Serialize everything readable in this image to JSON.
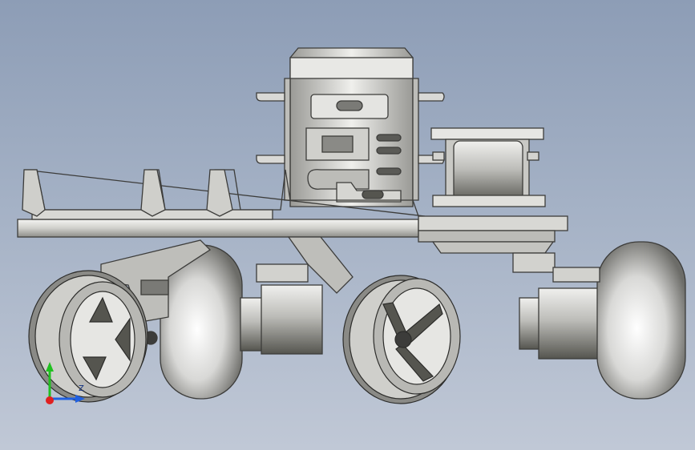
{
  "viewport": {
    "background_top": "#8d9db6",
    "background_bottom": "#c0c8d6",
    "model_name": "",
    "triad_axes": {
      "x_color": "#2060e0",
      "y_color": "#20c020",
      "z_color": "#e02020",
      "z_label": "Z"
    }
  },
  "model": {
    "icon": "robot-chassis-cad-model",
    "parts": [
      "chassis-plate",
      "upper-frame",
      "camera-mount",
      "battery-housing",
      "front-wheels",
      "rear-wheels",
      "suspension-arms"
    ]
  }
}
